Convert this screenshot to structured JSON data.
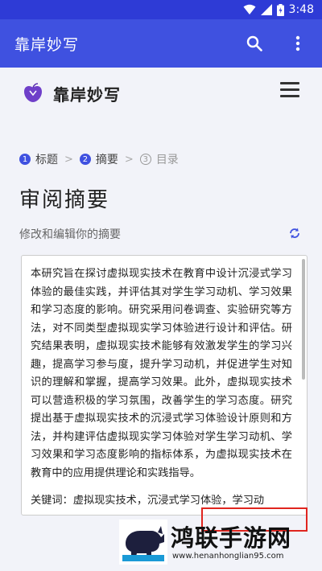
{
  "status_bar": {
    "time": "3:48"
  },
  "app_bar": {
    "title": "靠岸妙写"
  },
  "header": {
    "brand": "靠岸妙写"
  },
  "steps": [
    {
      "number": "1",
      "label": "标题",
      "active": true
    },
    {
      "number": "2",
      "label": "摘要",
      "active": true
    },
    {
      "number": "3",
      "label": "目录",
      "active": false
    }
  ],
  "page": {
    "title": "审阅摘要",
    "subtitle": "修改和编辑你的摘要",
    "abstract": "本研究旨在探讨虚拟现实技术在教育中设计沉浸式学习体验的最佳实践，并评估其对学生学习动机、学习效果和学习态度的影响。研究采用问卷调查、实验研究等方法，对不同类型虚拟现实学习体验进行设计和评估。研究结果表明，虚拟现实技术能够有效激发学生的学习兴趣，提高学习参与度，提升学习动机，并促进学生对知识的理解和掌握，提高学习效果。此外，虚拟现实技术可以营造积极的学习氛围，改善学生的学习态度。研究提出基于虚拟现实技术的沉浸式学习体验设计原则和方法，并构建评估虚拟现实学习体验对学生学习动机、学习效果和学习态度影响的指标体系，为虚拟现实技术在教育中的应用提供理论和实践指导。",
    "keywords_line": "关键词：虚拟现实技术，沉浸式学习体验，学习动"
  },
  "watermark": {
    "name": "鸿联手游网",
    "url": "www.henanhonglian95.com"
  },
  "colors": {
    "app_bar": "#3f51e0",
    "status_bar": "#2e3bd6",
    "highlight": "#e0251f"
  }
}
